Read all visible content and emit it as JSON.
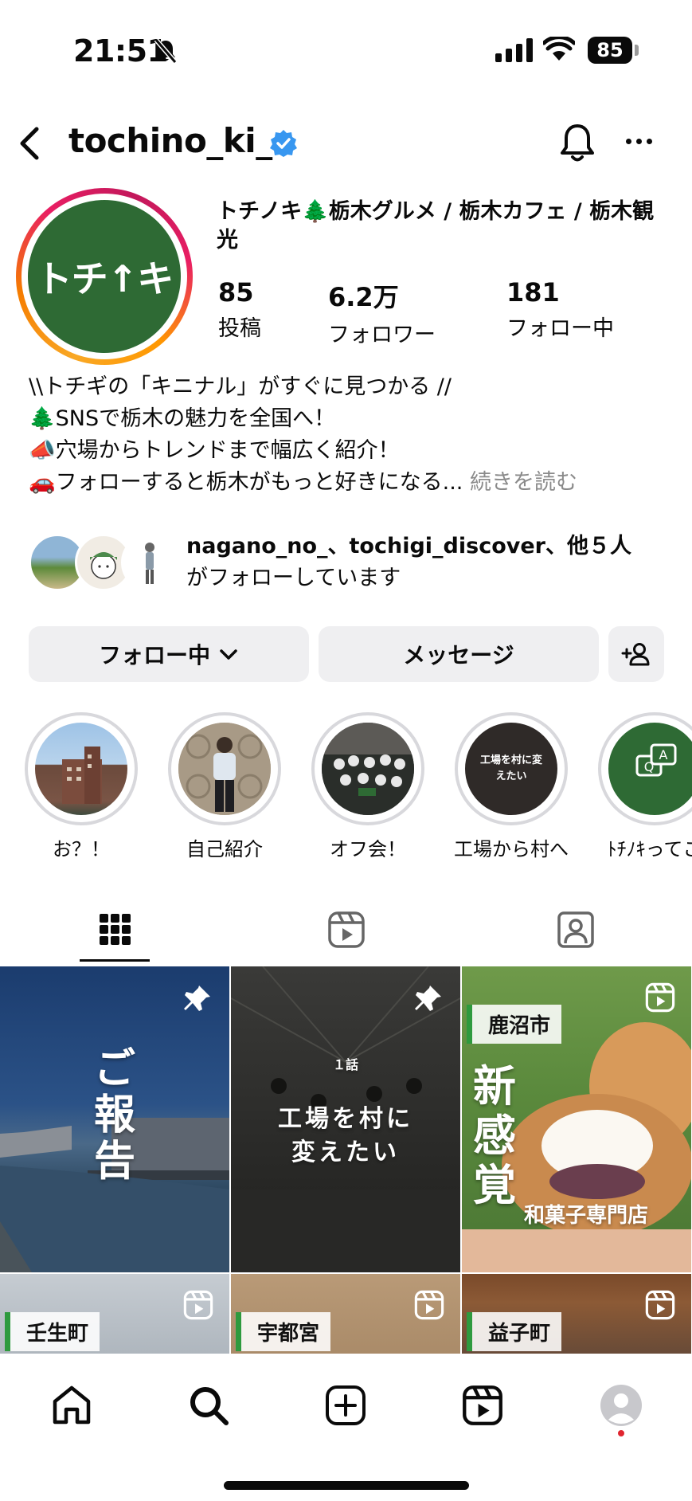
{
  "status_bar": {
    "time": "21:51",
    "battery": "85"
  },
  "header": {
    "username": "tochino_ki_"
  },
  "profile": {
    "avatar_text": "トチ↑キ",
    "display_name": "トチノキ🌲栃木グルメ / 栃木カフェ / 栃木観光",
    "stats": [
      {
        "value": "85",
        "label": "投稿"
      },
      {
        "value": "6.2万",
        "label": "フォロワー"
      },
      {
        "value": "181",
        "label": "フォロー中"
      }
    ],
    "bio": [
      "\\\\トチギの「キニナル」がすぐに見つかる //",
      "🌲SNSで栃木の魅力を全国へ！",
      "📣穴場からトレンドまで幅広く紹介！",
      "🚗フォローすると栃木がもっと好きになる..."
    ],
    "bio_more": "続きを読む",
    "followed_by_names": "nagano_no_、tochigi_discover、他５人",
    "followed_by_suffix": "がフォローしています"
  },
  "buttons": {
    "following": "フォロー中",
    "message": "メッセージ"
  },
  "highlights": [
    {
      "label": "お？！"
    },
    {
      "label": "自己紹介"
    },
    {
      "label": "オフ会！"
    },
    {
      "label": "工場から村へ",
      "inner_text": "工場を村に変えたい"
    },
    {
      "label": "ﾄﾁﾉｷってこ"
    }
  ],
  "grid": {
    "posts": [
      {
        "title": "ご報告"
      },
      {
        "episode": "１話",
        "title_line1": "工場を村に",
        "title_line2": "変えたい"
      },
      {
        "tag": "鹿沼市",
        "title": "新感覚",
        "subtitle": "和菓子専門店"
      },
      {
        "tag": "壬生町"
      },
      {
        "tag": "宇都宮"
      },
      {
        "tag": "益子町"
      }
    ]
  },
  "colors": {
    "brand_green": "#2e6a34",
    "accent_blue": "#3897f0"
  }
}
